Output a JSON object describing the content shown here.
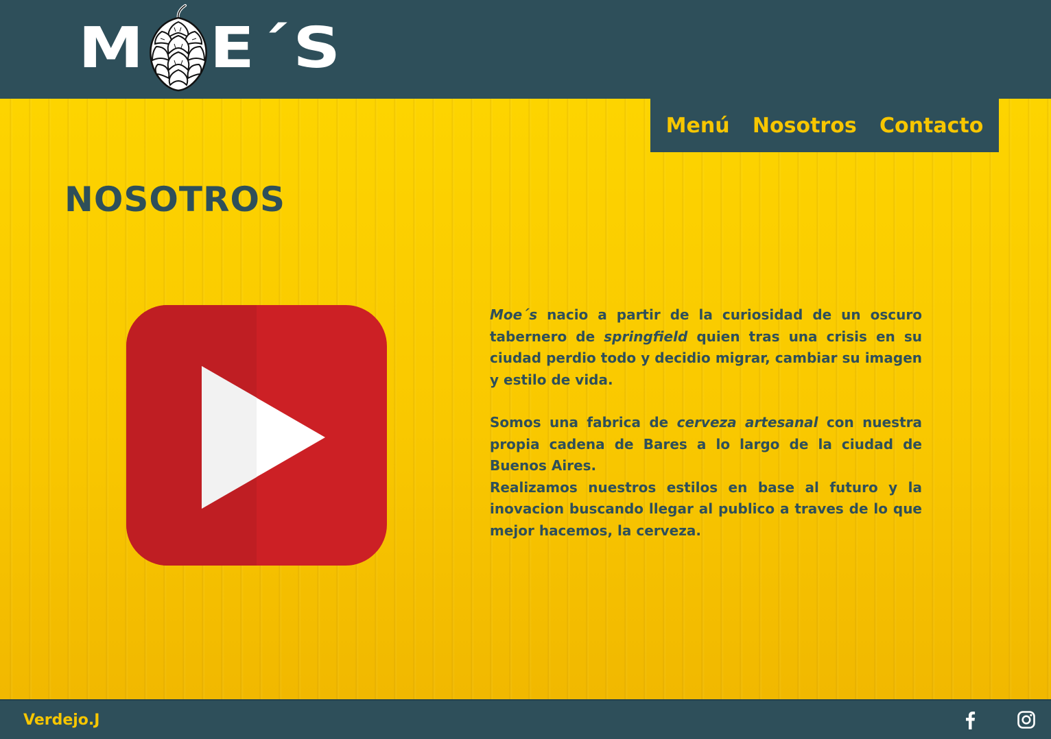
{
  "header": {
    "logo": {
      "before": "M",
      "after": "E´S"
    }
  },
  "nav": {
    "items": [
      {
        "label": "Menú"
      },
      {
        "label": "Nosotros"
      },
      {
        "label": "Contacto"
      }
    ]
  },
  "main": {
    "title": "NOSOTROS",
    "video_icon": "youtube-play-icon",
    "paragraph1": {
      "brand": "Moe´s",
      "text_a": " nacio a partir de la curiosidad de un oscuro tabernero de ",
      "place": "springfield",
      "text_b": " quien tras una crisis en su ciudad perdio todo y decidio migrar, cambiar su imagen y estilo de vida."
    },
    "paragraph2": {
      "text_a": "Somos una fabrica de ",
      "highlight": "cerveza artesanal",
      "text_b": " con nuestra propia cadena de Bares a lo largo de la ciudad de Buenos Aires."
    },
    "paragraph3": "Realizamos nuestros estilos en base al futuro y la inovacion buscando llegar al publico a traves de lo que mejor hacemos, la cerveza."
  },
  "footer": {
    "author": "Verdejo.J",
    "social": [
      "facebook-icon",
      "instagram-icon"
    ]
  },
  "colors": {
    "primary": "#2e4f5a",
    "accent": "#f7c600",
    "video_red": "#cc2025"
  }
}
